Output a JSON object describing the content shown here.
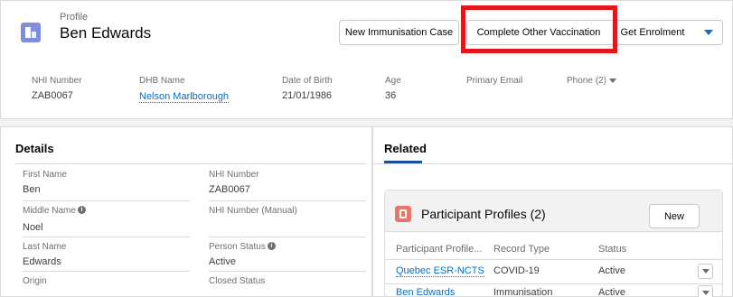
{
  "header": {
    "object_label": "Profile",
    "record_name": "Ben Edwards",
    "buttons": {
      "new_immunisation": "New Immunisation Case",
      "complete_other": "Complete Other Vaccination",
      "get_enrolment": "Get Enrolment"
    },
    "fields": {
      "nhi_label": "NHI Number",
      "nhi_value": "ZAB0067",
      "dhb_label": "DHB Name",
      "dhb_value": "Nelson Marlborough",
      "dob_label": "Date of Birth",
      "dob_value": "21/01/1986",
      "age_label": "Age",
      "age_value": "36",
      "email_label": "Primary Email",
      "phone_label": "Phone (2)"
    }
  },
  "details": {
    "title": "Details",
    "first_name_label": "First Name",
    "first_name_value": "Ben",
    "middle_name_label": "Middle Name",
    "middle_name_value": "Noel",
    "last_name_label": "Last Name",
    "last_name_value": "Edwards",
    "origin_label": "Origin",
    "nhi_label": "NHI Number",
    "nhi_value": "ZAB0067",
    "nhi_manual_label": "NHI Number (Manual)",
    "person_status_label": "Person Status",
    "person_status_value": "Active",
    "closed_status_label": "Closed Status"
  },
  "related": {
    "tab_label": "Related",
    "list_title": "Participant Profiles (2)",
    "new_button": "New",
    "columns": [
      "Participant Profile...",
      "Record Type",
      "Status"
    ],
    "rows": [
      {
        "name": "Quebec ESR-NCTS",
        "record_type": "COVID-19",
        "status": "Active"
      },
      {
        "name": "Ben Edwards",
        "record_type": "Immunisation",
        "status": "Active"
      }
    ]
  },
  "colors": {
    "accent": "#0070d2",
    "highlight": "#e5161b",
    "profile_icon": "#7f8de1",
    "participant_icon": "#e8766a"
  }
}
